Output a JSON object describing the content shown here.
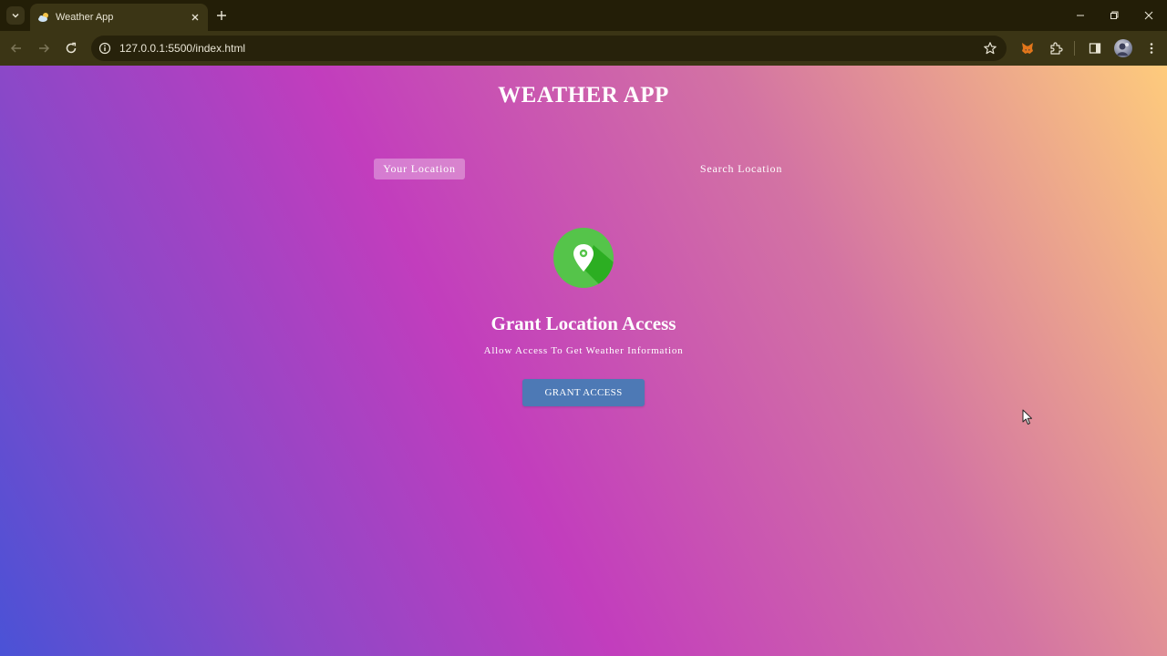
{
  "browser": {
    "tab": {
      "title": "Weather App",
      "favicon": "cloud-sun-icon"
    },
    "address_bar": {
      "url": "127.0.0.1:5500/index.html"
    },
    "icons": {
      "tab_search": "chevron-down-icon",
      "new_tab": "plus-icon",
      "back": "arrow-left-icon",
      "forward": "arrow-right-icon",
      "reload": "reload-icon",
      "site_info": "info-icon",
      "bookmark": "star-icon",
      "extension_1": "metamask-fox-icon",
      "extensions": "puzzle-icon",
      "side_panel": "side-panel-icon",
      "profile": "avatar-icon",
      "menu": "kebab-menu-icon"
    }
  },
  "app": {
    "title": "WEATHER APP",
    "tabs": [
      {
        "label": "Your Location",
        "active": true
      },
      {
        "label": "Search Location",
        "active": false
      }
    ],
    "grant_section": {
      "icon": "location-pin-icon",
      "heading": "Grant Location Access",
      "subheading": "Allow Access To Get Weather Information",
      "button_label": "GRANT ACCESS"
    }
  },
  "colors": {
    "chrome_dark": "#231e07",
    "chrome_toolbar": "#3b3515",
    "gradient_start": "#4a52d6",
    "gradient_mid": "#c23dbd",
    "gradient_end": "#fecb7c",
    "button": "#4d79b5",
    "pin_circle": "#55c44a"
  }
}
